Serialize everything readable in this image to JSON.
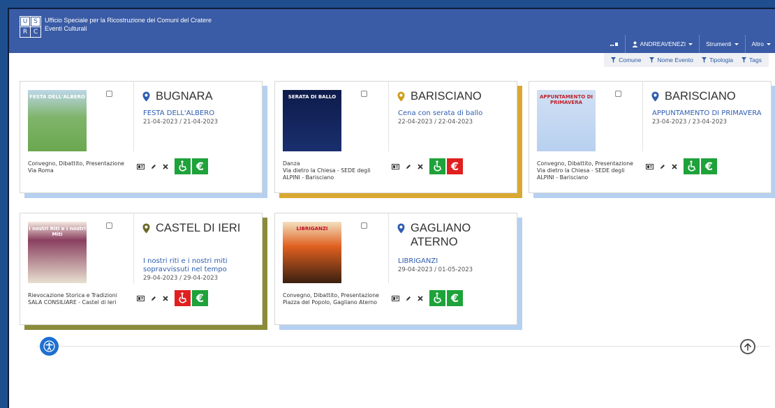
{
  "header": {
    "logo": {
      "l1": "U",
      "l2": "S",
      "l3": "R",
      "l4": "C"
    },
    "title_line1": "Ufficio Speciale per la Ricostruzione dei Comuni del Cratere",
    "title_line2": "Eventi Culturali",
    "nav": {
      "user": "ANDREAVENEZI",
      "tools": "Strumenti",
      "more": "Altro"
    }
  },
  "filters": [
    "Comune",
    "Nome Evento",
    "Tipologia",
    "Tags"
  ],
  "cards": [
    {
      "location": "BUGNARA",
      "event": "FESTA DELL'ALBERO",
      "dates": "21-04-2023 / 21-04-2023",
      "type": "Convegno, Dibattito, Presentazione",
      "place": "Via Roma",
      "place2": "",
      "pin_color": "#2f5db0",
      "shadow": "#b6d0f0",
      "accessible": "green",
      "price": "green",
      "thumb": {
        "top": "FESTA DELL'ALBERO"
      }
    },
    {
      "location": "BARISCIANO",
      "event": "Cena con serata di ballo",
      "dates": "22-04-2023 / 22-04-2023",
      "type": "Danza",
      "place": "Via dietro la Chiesa - SEDE degli",
      "place2": "ALPINI - Barisciano",
      "pin_color": "#d19d19",
      "shadow": "#d9a831",
      "accessible": "green",
      "price": "red",
      "thumb": {
        "top": "SERATA DI BALLO"
      }
    },
    {
      "location": "BARISCIANO",
      "event": "APPUNTAMENTO DI PRIMAVERA",
      "dates": "23-04-2023 / 23-04-2023",
      "type": "Convegno, Dibattito, Presentazione",
      "place": "Via dietro la Chiesa - SEDE degli",
      "place2": "ALPINI - Barisciano",
      "pin_color": "#2f5db0",
      "shadow": "#b6d0f0",
      "accessible": "green",
      "price": "green",
      "thumb": {
        "top": "APPUNTAMENTO DI PRIMAVERA"
      }
    },
    {
      "location": "CASTEL DI IERI",
      "event": "I nostri riti e i nostri miti sopravvissuti nel tempo",
      "dates": "29-04-2023 / 29-04-2023",
      "type": "Rievocazione Storica e Tradizioni",
      "place": "SALA CONSILIARE - Castel di Ieri",
      "place2": "",
      "pin_color": "#6a6a2a",
      "shadow": "#8b8b3a",
      "accessible": "red",
      "price": "green",
      "thumb": {
        "top": "I nostri Riti e i nostri Miti"
      }
    },
    {
      "location": "GAGLIANO ATERNO",
      "event": "LIBRIGANZI",
      "dates": "29-04-2023 / 01-05-2023",
      "type": "Convegno, Dibattito, Presentazione",
      "place": "Piazza del Popolo, Gagliano Aterno",
      "place2": "",
      "pin_color": "#2f5db0",
      "shadow": "#b6d0f0",
      "accessible": "green",
      "price": "green",
      "thumb": {
        "top": "LIBRIGANZI"
      }
    }
  ]
}
